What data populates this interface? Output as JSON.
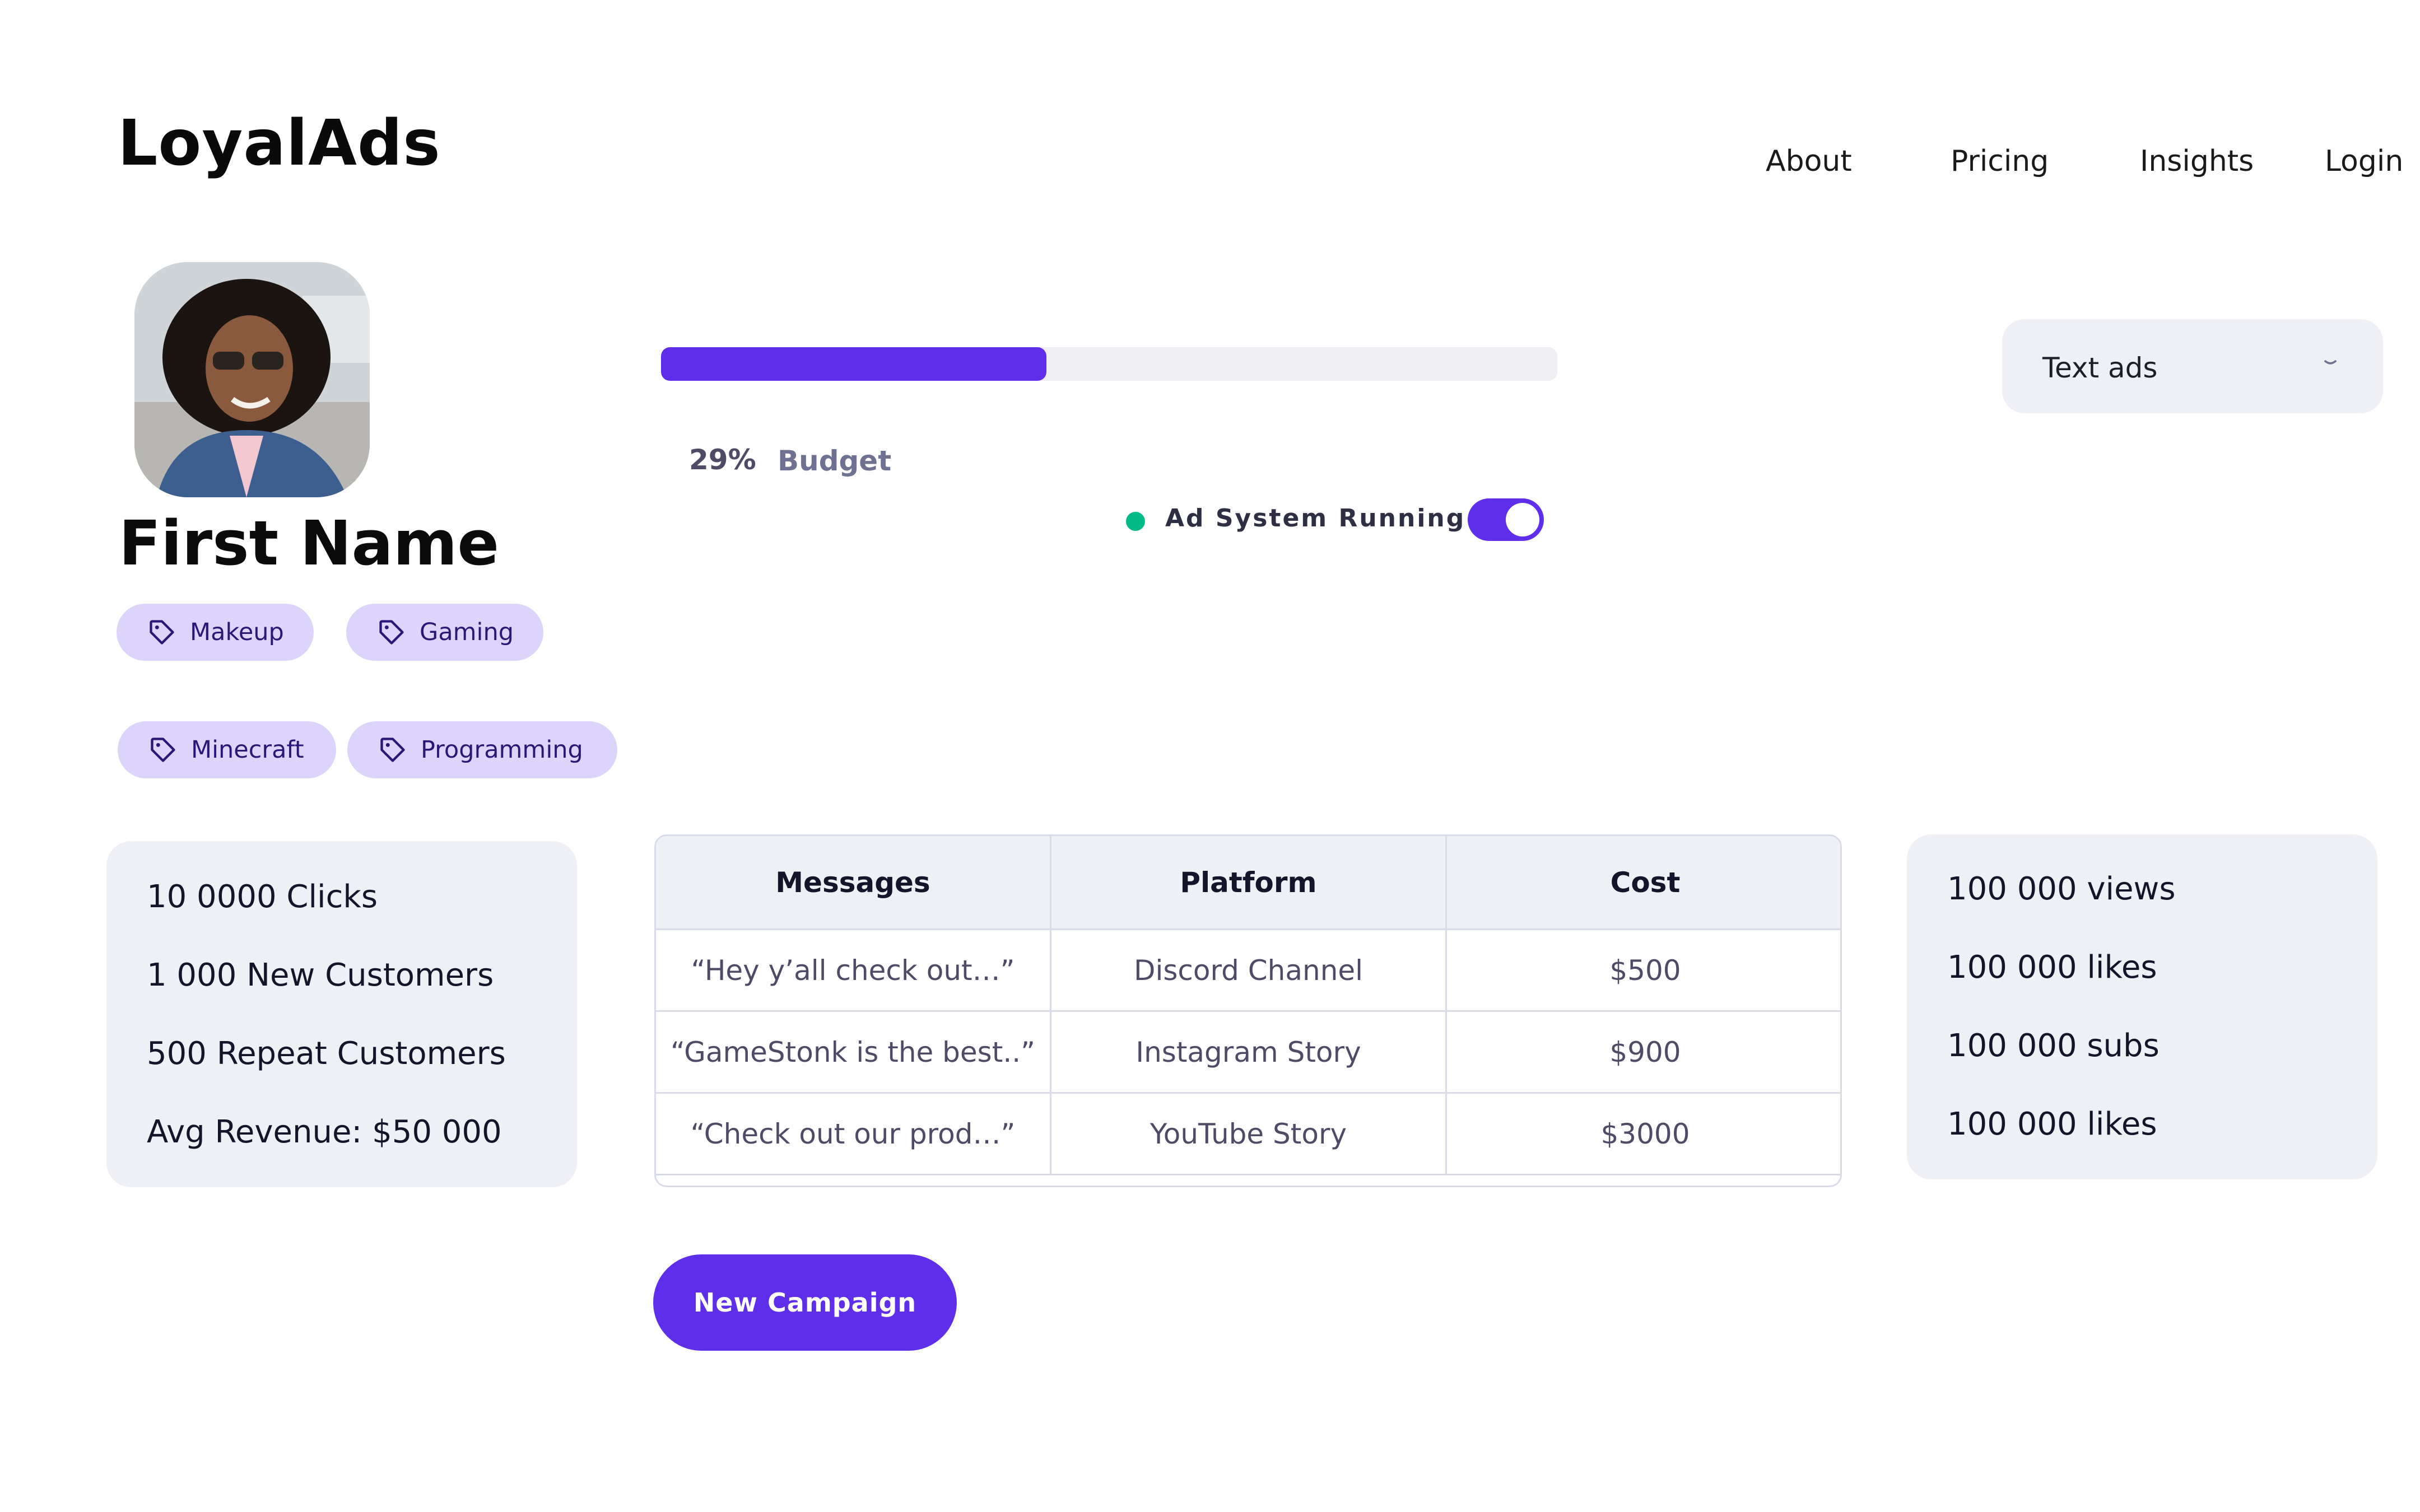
{
  "brand": {
    "name": "LoyalAds"
  },
  "nav": {
    "items": [
      "About",
      "Pricing",
      "Insights",
      "Login"
    ]
  },
  "profile": {
    "name": "First Name",
    "tags": [
      "Makeup",
      "Gaming",
      "Minecraft",
      "Programming"
    ]
  },
  "budget": {
    "percent_label": "29%",
    "label": "Budget",
    "fraction": 0.43
  },
  "ad_system": {
    "label": "Ad System Running",
    "enabled": true
  },
  "dropdown": {
    "value": "Text ads"
  },
  "stats_left": [
    "10 0000 Clicks",
    "1 000 New Customers",
    "500 Repeat Customers",
    "Avg Revenue: $50 000"
  ],
  "table": {
    "headers": [
      "Messages",
      "Platform",
      "Cost"
    ],
    "rows": [
      [
        "“Hey y’all check out…”",
        "Discord Channel",
        "$500"
      ],
      [
        "“GameStonk is the best..”",
        "Instagram Story",
        "$900"
      ],
      [
        "“Check out our prod…”",
        "YouTube Story",
        "$3000"
      ]
    ]
  },
  "stats_right": [
    "100 000 views",
    "100 000 likes",
    "100 000 subs",
    "100 000 likes"
  ],
  "cta": {
    "label": "New Campaign"
  },
  "colors": {
    "accent": "#5f2eea",
    "tag_bg": "#ddd4fb",
    "card_bg": "#eff0f6",
    "status": "#00ba88"
  }
}
